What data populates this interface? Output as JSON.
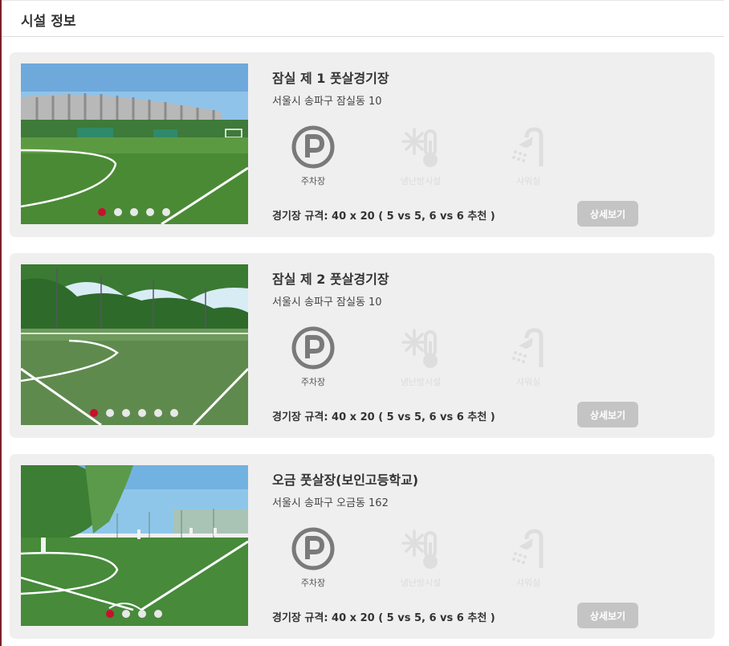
{
  "header": {
    "title": "시설 정보"
  },
  "facilities": [
    {
      "name": "잠실 제 1 풋살경기장",
      "address": "서울시 송파구 잠실동 10",
      "amenities": [
        {
          "label": "주차장",
          "icon": "parking-icon",
          "available": true
        },
        {
          "label": "냉난방시설",
          "icon": "climate-control-icon",
          "available": false
        },
        {
          "label": "샤워실",
          "icon": "shower-icon",
          "available": false
        }
      ],
      "spec": "경기장 규격: 40 x 20 ( 5 vs 5, 6 vs 6 추천 )",
      "detail_label": "상세보기",
      "slides_total": 5,
      "slide_active": 1
    },
    {
      "name": "잠실 제 2 풋살경기장",
      "address": "서울시 송파구 잠실동 10",
      "amenities": [
        {
          "label": "주차장",
          "icon": "parking-icon",
          "available": true
        },
        {
          "label": "냉난방시설",
          "icon": "climate-control-icon",
          "available": false
        },
        {
          "label": "샤워실",
          "icon": "shower-icon",
          "available": false
        }
      ],
      "spec": "경기장 규격: 40 x 20 ( 5 vs 5, 6 vs 6 추천 )",
      "detail_label": "상세보기",
      "slides_total": 6,
      "slide_active": 1
    },
    {
      "name": "오금 풋살장(보인고등학교)",
      "address": "서울시 송파구 오금동 162",
      "amenities": [
        {
          "label": "주차장",
          "icon": "parking-icon",
          "available": true
        },
        {
          "label": "냉난방시설",
          "icon": "climate-control-icon",
          "available": false
        },
        {
          "label": "샤워실",
          "icon": "shower-icon",
          "available": false
        }
      ],
      "spec": "경기장 규격: 40 x 20 ( 5 vs 5, 6 vs 6 추천 )",
      "detail_label": "상세보기",
      "slides_total": 4,
      "slide_active": 1
    }
  ],
  "colors": {
    "active_dot": "#c8102e",
    "card_bg": "#efefef",
    "button_bg": "#c4c4c4",
    "icon_on": "#7a7a7a",
    "icon_off": "#dedede"
  }
}
